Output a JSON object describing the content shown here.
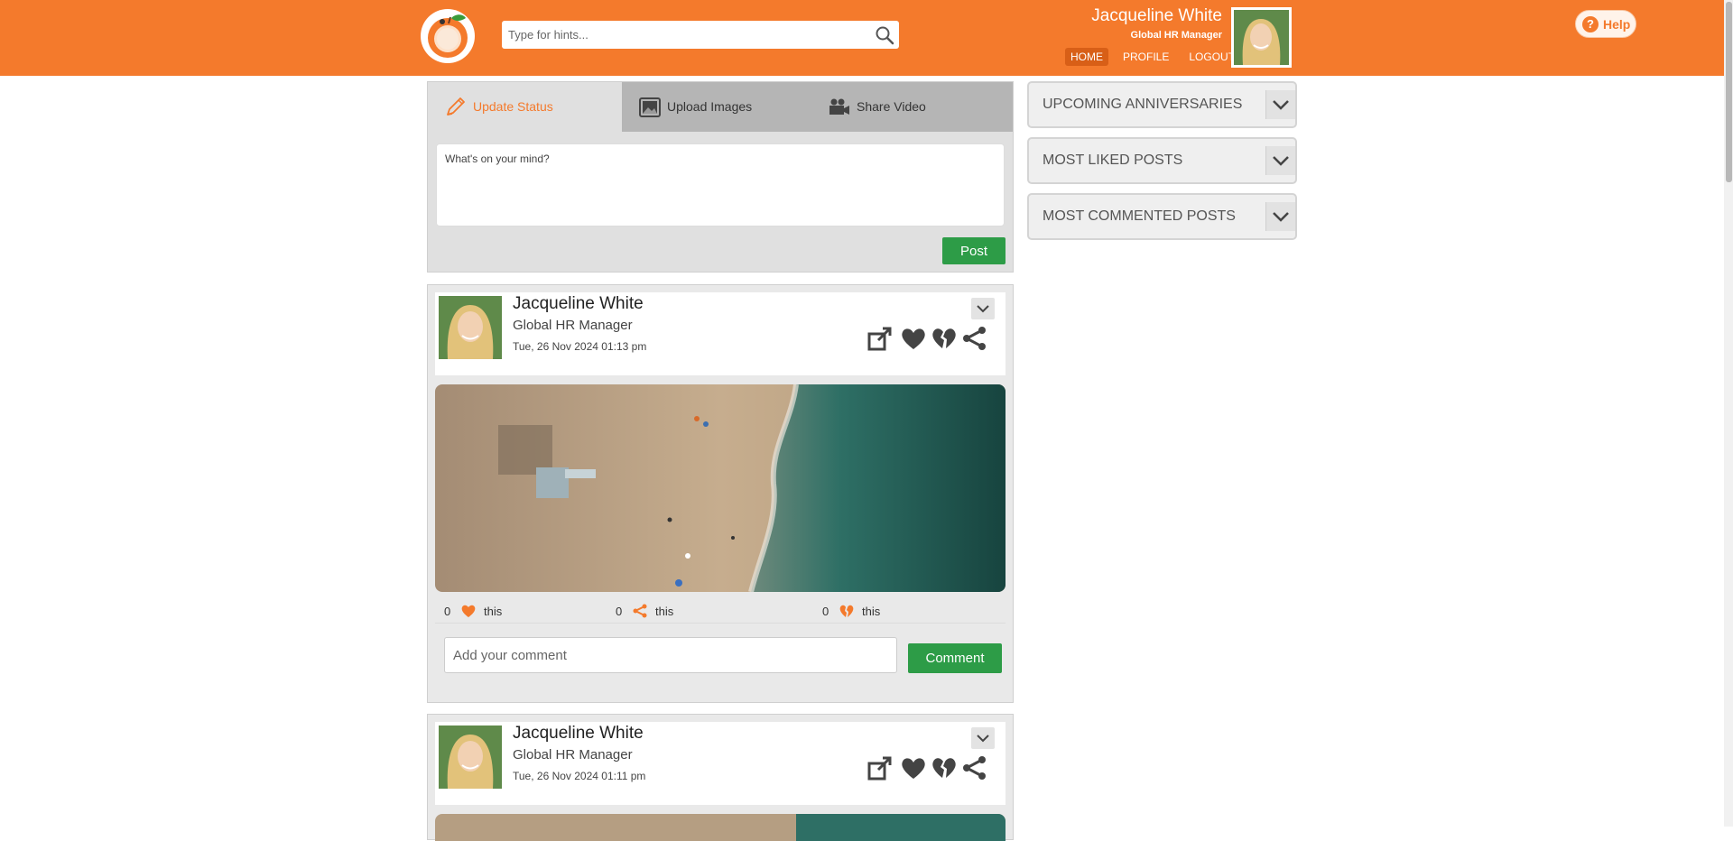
{
  "header": {
    "search_placeholder": "Type for hints...",
    "user_name": "Jacqueline White",
    "user_role": "Global HR Manager",
    "nav": {
      "home": "HOME",
      "profile": "PROFILE",
      "logout": "LOGOUT"
    },
    "help_label": "Help",
    "brand_color": "#f47a2c"
  },
  "composer": {
    "tabs": {
      "update_status": "Update Status",
      "upload_images": "Upload Images",
      "share_video": "Share Video"
    },
    "status_placeholder": "What's on your mind?",
    "post_button": "Post"
  },
  "posts": [
    {
      "author": "Jacqueline White",
      "role": "Global HR Manager",
      "timestamp": "Tue, 26 Nov 2024  01:13 pm",
      "likes": "0",
      "shares": "0",
      "dislikes": "0",
      "this_label": "this",
      "comment_placeholder": "Add your comment",
      "comment_button": "Comment"
    },
    {
      "author": "Jacqueline White",
      "role": "Global HR Manager",
      "timestamp": "Tue, 26 Nov 2024  01:11 pm"
    }
  ],
  "sidebar": {
    "widgets": [
      {
        "title": "UPCOMING ANNIVERSARIES"
      },
      {
        "title": "MOST LIKED POSTS"
      },
      {
        "title": "MOST COMMENTED POSTS"
      }
    ]
  },
  "colors": {
    "accent": "#f47a2c",
    "post_button": "#2d9c47",
    "panel": "#e0e0e0"
  },
  "icons": [
    "search-icon",
    "pencil-icon",
    "image-icon",
    "video-camera-icon",
    "chevron-down-icon",
    "share-out-icon",
    "heart-icon",
    "broken-heart-icon",
    "share-icon",
    "help-icon"
  ]
}
